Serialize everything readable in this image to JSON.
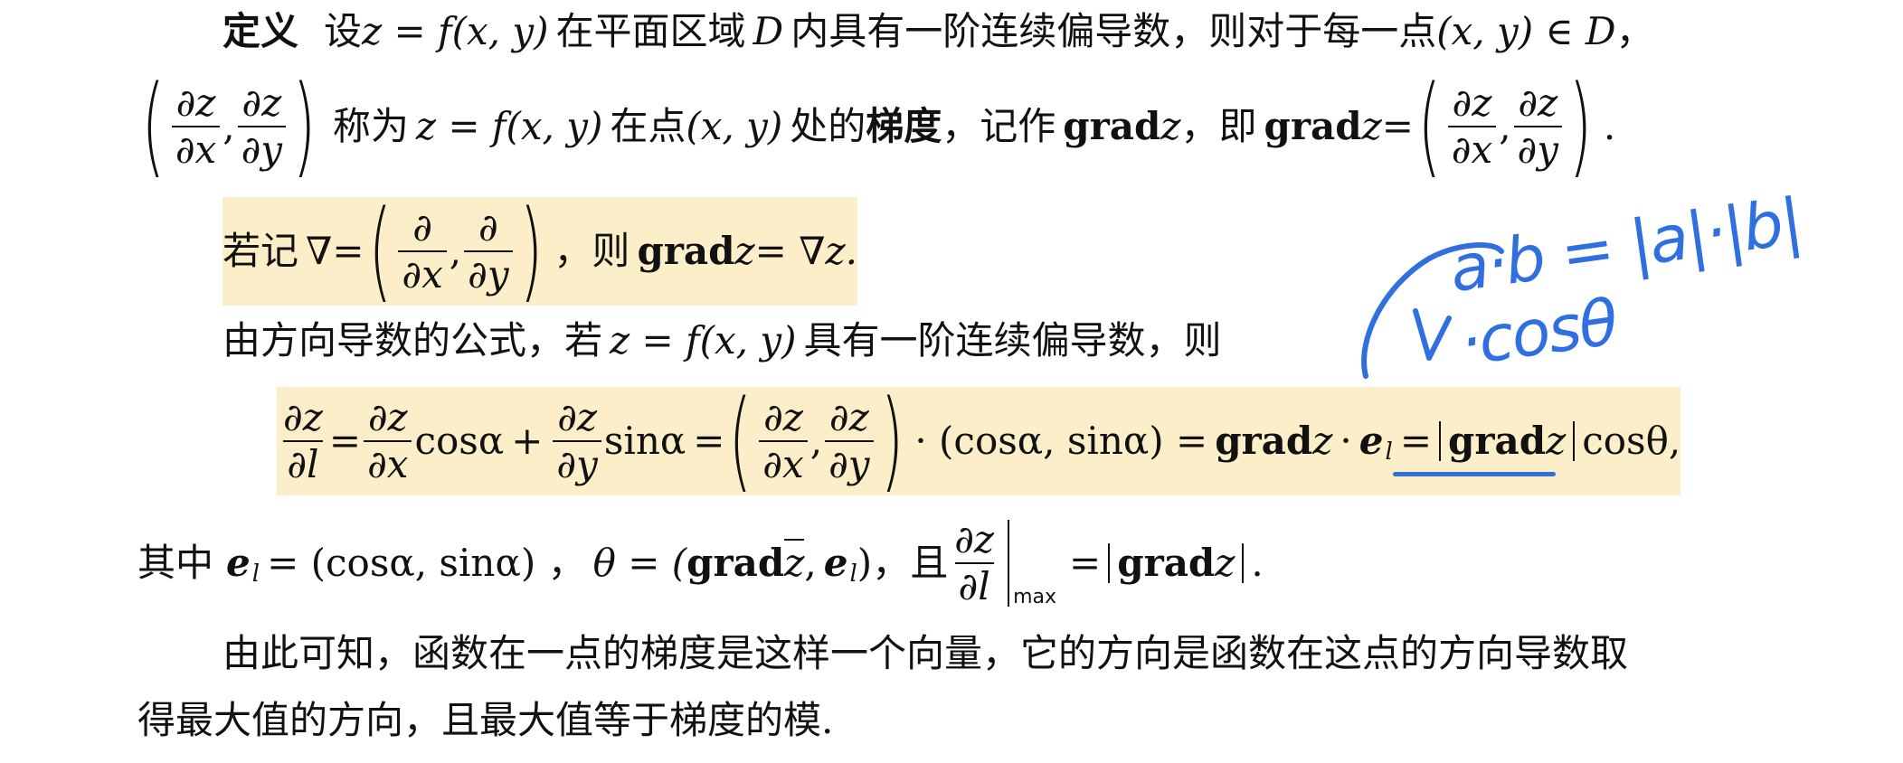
{
  "definition": {
    "heading": "定义",
    "l1_a": "设",
    "l1_expr": "z = f(x, y)",
    "l1_b": "在平面区域",
    "l1_D": "D",
    "l1_c": "内具有一阶连续偏导数，则对于每一点",
    "l1_pt": "(x, y) ∈ D",
    "l1_end": "，",
    "l2_num": "∂z",
    "l2_den1": "∂x",
    "l2_den2": "∂y",
    "l2_a": "称为",
    "l2_expr": "z = f(x, y)",
    "l2_b": "在点",
    "l2_pt": "(x, y)",
    "l2_c": "处的",
    "l2_term": "梯度",
    "l2_d": "，记作",
    "grad": "grad",
    "z": "z",
    "l2_e": "，即",
    "eq": "=",
    "period": "."
  },
  "nabla_line": {
    "a": "若记",
    "nabla": "∇",
    "eq": "=",
    "num": "∂",
    "den1": "∂x",
    "den2": "∂y",
    "b": "，则",
    "rhs": "= ∇z."
  },
  "directional": {
    "text": "由方向导数的公式，若",
    "expr": "z = f(x, y)",
    "text2": "具有一阶连续偏导数，则"
  },
  "formula": {
    "lhs_num": "∂z",
    "lhs_den": "∂l",
    "fx_num": "∂z",
    "fx_den": "∂x",
    "cos": "cosα",
    "plus": "+",
    "fy_num": "∂z",
    "fy_den": "∂y",
    "sin": "sinα",
    "dot_vec": "· (cosα, sinα) =",
    "dot": "·",
    "e": "e",
    "l": "l",
    "costheta": "cosθ,",
    "eq": "="
  },
  "where_line": {
    "a": "其中",
    "e": "e",
    "l": "l",
    "b": "= (cosα, sinα) ，",
    "theta": "θ = (",
    "comma": ",",
    "close": ")",
    "c": "，且",
    "num": "∂z",
    "den": "∂l",
    "max": "max",
    "eq": "=",
    "period": "."
  },
  "conclusion": {
    "l1_a": "由此可知，",
    "l1_hl": "函数在一点的梯度是这样一个向量",
    "l1_b": "，它的方向是函数在这点的方向导数取",
    "l2_a": "得最大值的方向，",
    "l2_hl": "且最大值等于梯度的模",
    "l2_b": "."
  },
  "annotation": {
    "text": "a·b = |a|·|b|·cosθ"
  }
}
